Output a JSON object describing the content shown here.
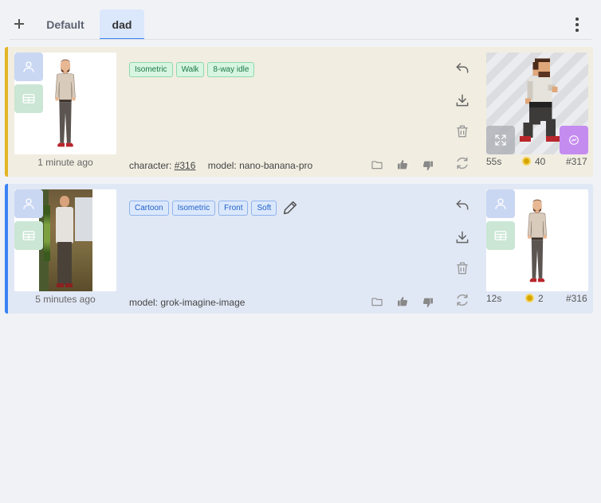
{
  "tabs": [
    {
      "label": "Default",
      "active": false
    },
    {
      "label": "dad",
      "active": true
    }
  ],
  "icons": {
    "add": "plus-icon",
    "menu": "kebab-menu-icon",
    "person": "person-icon",
    "sheet": "spritesheet-icon",
    "undo": "undo-icon",
    "download": "download-icon",
    "delete": "trash-icon",
    "regenerate": "refresh-icon",
    "folder": "folder-icon",
    "like": "thumbs-up-icon",
    "dislike": "thumbs-down-icon",
    "edit": "pencil-icon",
    "expand": "expand-icon",
    "animate": "animate-icon"
  },
  "colors": {
    "accent": "#3b82f6",
    "card1_bg": "#f1ede1",
    "card1_border": "#e2b523",
    "card2_bg": "#e1e8f5",
    "card2_border": "#3b82f6",
    "green_tag": "#1b7a45",
    "blue_tag": "#1f5fc9"
  },
  "cards": [
    {
      "time": "1 minute ago",
      "tags": [
        "Isometric",
        "Walk",
        "8-way idle"
      ],
      "character_label": "character:",
      "character_link": "#316",
      "model_label": "model:",
      "model": "nano-banana-pro",
      "duration": "55s",
      "cost": "40",
      "id": "#317"
    },
    {
      "time": "5 minutes ago",
      "tags": [
        "Cartoon",
        "Isometric",
        "Front",
        "Soft"
      ],
      "model_label": "model:",
      "model": "grok-imagine-image",
      "duration": "12s",
      "cost": "2",
      "id": "#316"
    }
  ]
}
